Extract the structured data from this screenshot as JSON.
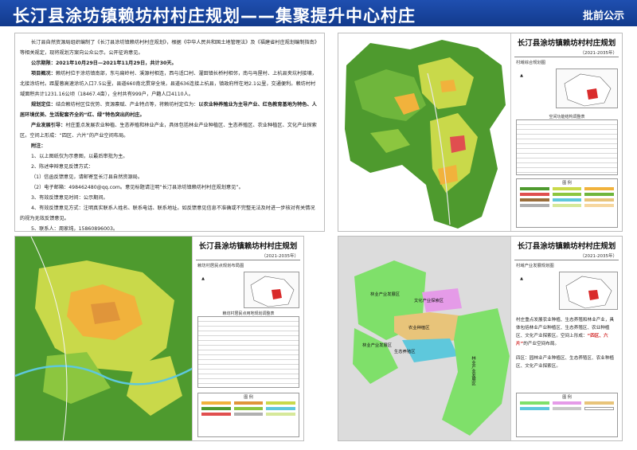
{
  "header": {
    "title": "长汀县涂坊镇赖坊村村庄规划——集聚提升中心村庄",
    "badge": "批前公示"
  },
  "notice": {
    "intro": "长汀县自然资源局组织编制了《长汀县涂坊镇赖坊村村庄规划》，根据《中华人民共和国土地管理法》及《福建省村庄规划编制指南》等相关规定，现将规划方案向公众公示，公开征询意见。",
    "period_label": "公示期限：",
    "period": "2021年10月29日—2021年11月29日，共计30天。",
    "overview_label": "项目概况：",
    "overview": "赖坊村位于涂坊镇南部，东与扁岭村、溪源村相连，西与适口村、濯田镇长桥村相邻，南与马屋村、上杭县夹坑村接壤，北接涂坊村。距厦蓉高速涂坊入口7.5公里，县道660南北贯穿全境，县道636连接上杭县，镇政府所在地2.1公里，交通便利。赖坊村村域面积共计1231.16公顷（18467.4亩），全村共有999户，户籍人口4110人。",
    "positioning_label": "规划定位：",
    "positioning_pre": "结合赖坊村区位优势、资源禀赋、产业特点等，将赖坊村定位为：",
    "positioning_bold": "以农业种养殖业为主导产业、红色教育基地为特色、人居环境优美、生活配套齐全的“红、绿”特色突出的村庄。",
    "industry_label": "产业发展引导：",
    "industry": "村庄重点发展农业种植、生态养殖和林业产业，具体包括林业产业种植区、生态养殖区、农业种植区、文化产业探索区。空间上形成：“四区、六片”的产业空间布局。",
    "notes_label": "附注：",
    "notes": [
      "1、以上图纸仅为示意图，以最后审批为主。",
      "2、陈述申辩意见反馈方式：",
      "（1）信函反馈意见，请邮寄至长汀县自然资源局。",
      "（2）电子邮箱：498462480@qq.com。意见标题请注明“长汀县涂坊镇赖坊村村庄规划意见”。",
      "3、有效反馈意见时间：公示期间。",
      "4、有效反馈意见方式：注明真实联系人姓名、联系电话、联系地址。如反馈意见信息不准确或不完整无法及时进一步核对有关情况的视为无效反馈意见。",
      "5、联系人：周家纯，15860896003。"
    ]
  },
  "panels": {
    "top_right": {
      "title": "长汀县涂坊镇赖坊村村庄规划",
      "years": "（2021-2035年）",
      "subtitle": "村域综合规划图",
      "table_caption": "空间功能结构调整表",
      "legend_caption": "图 例"
    },
    "bottom_left": {
      "title": "长汀县涂坊镇赖坊村村庄规划",
      "years": "（2021-2035年）",
      "subtitle": "赖坊村居民点规划布局图",
      "table_caption": "赖坊村居民点用地规划调整表",
      "legend_caption": "图 例"
    },
    "bottom_right": {
      "title": "长汀县涂坊镇赖坊村村庄规划",
      "years": "（2021-2035年）",
      "subtitle": "村域产业发展规划图",
      "desc_pre": "村庄重点发展农业种植、生态养殖和林业产业，具体包括林业产业种植区、生态养殖区、农业种植区、文化产业探索区。空间上形成：",
      "desc_hl": "“四区、六片”",
      "desc_post": "的产业空间布局。",
      "extra": "四区：园林业产业种植区、生态养殖区、农业种植区、文化产业探索区。",
      "zones": [
        "林业产业发展区",
        "文化产业探索区",
        "林业产业发展区",
        "农业种植区",
        "生态养殖区",
        "林业产业发展区"
      ],
      "legend_caption": "图 例"
    }
  },
  "colors": {
    "title_bar": "#1f4fb0",
    "forest": "#4e9a2e",
    "farmland": "#c9d94a",
    "village": "#f1b23c",
    "industry_green": "#7fe06a",
    "culture_pink": "#e59be8",
    "aquaculture_blue": "#5ec8dc",
    "agri_tan": "#e8c47a"
  }
}
